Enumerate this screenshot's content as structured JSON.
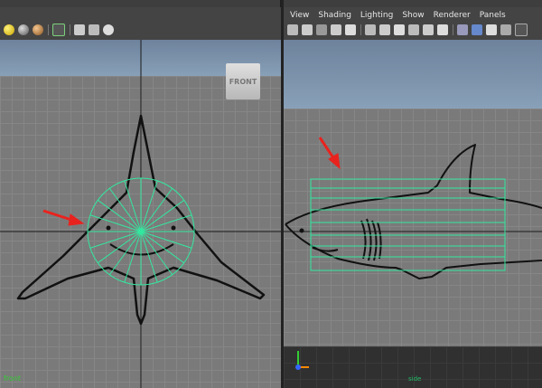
{
  "left_viewport": {
    "camera_label": "front",
    "view_cube_label": "FRONT"
  },
  "right_viewport": {
    "menu": [
      "View",
      "Shading",
      "Lighting",
      "Show",
      "Renderer",
      "Panels"
    ],
    "camera_label": "side"
  },
  "colors": {
    "wireframe": "#33e8a0",
    "arrow": "#e8231e",
    "camera_label": "#33cc33"
  },
  "icons": {
    "left_toolbar": [
      "light-ball-icon",
      "shaded-ball-icon",
      "textured-ball-icon",
      "select-camera-icon",
      "bookmark-camera-icon",
      "lock-camera-icon",
      "camera-attributes-icon"
    ],
    "right_toolbar": [
      "select-camera-icon",
      "camera-attributes-icon",
      "bookmark-icon",
      "image-plane-icon",
      "2d-pan-icon",
      "grid-icon",
      "film-gate-icon",
      "resolution-gate-icon",
      "safe-action-icon",
      "safe-title-icon",
      "field-chart-icon",
      "wireframe-icon",
      "smooth-shade-icon",
      "textured-icon",
      "lights-icon",
      "shadows-icon"
    ]
  }
}
